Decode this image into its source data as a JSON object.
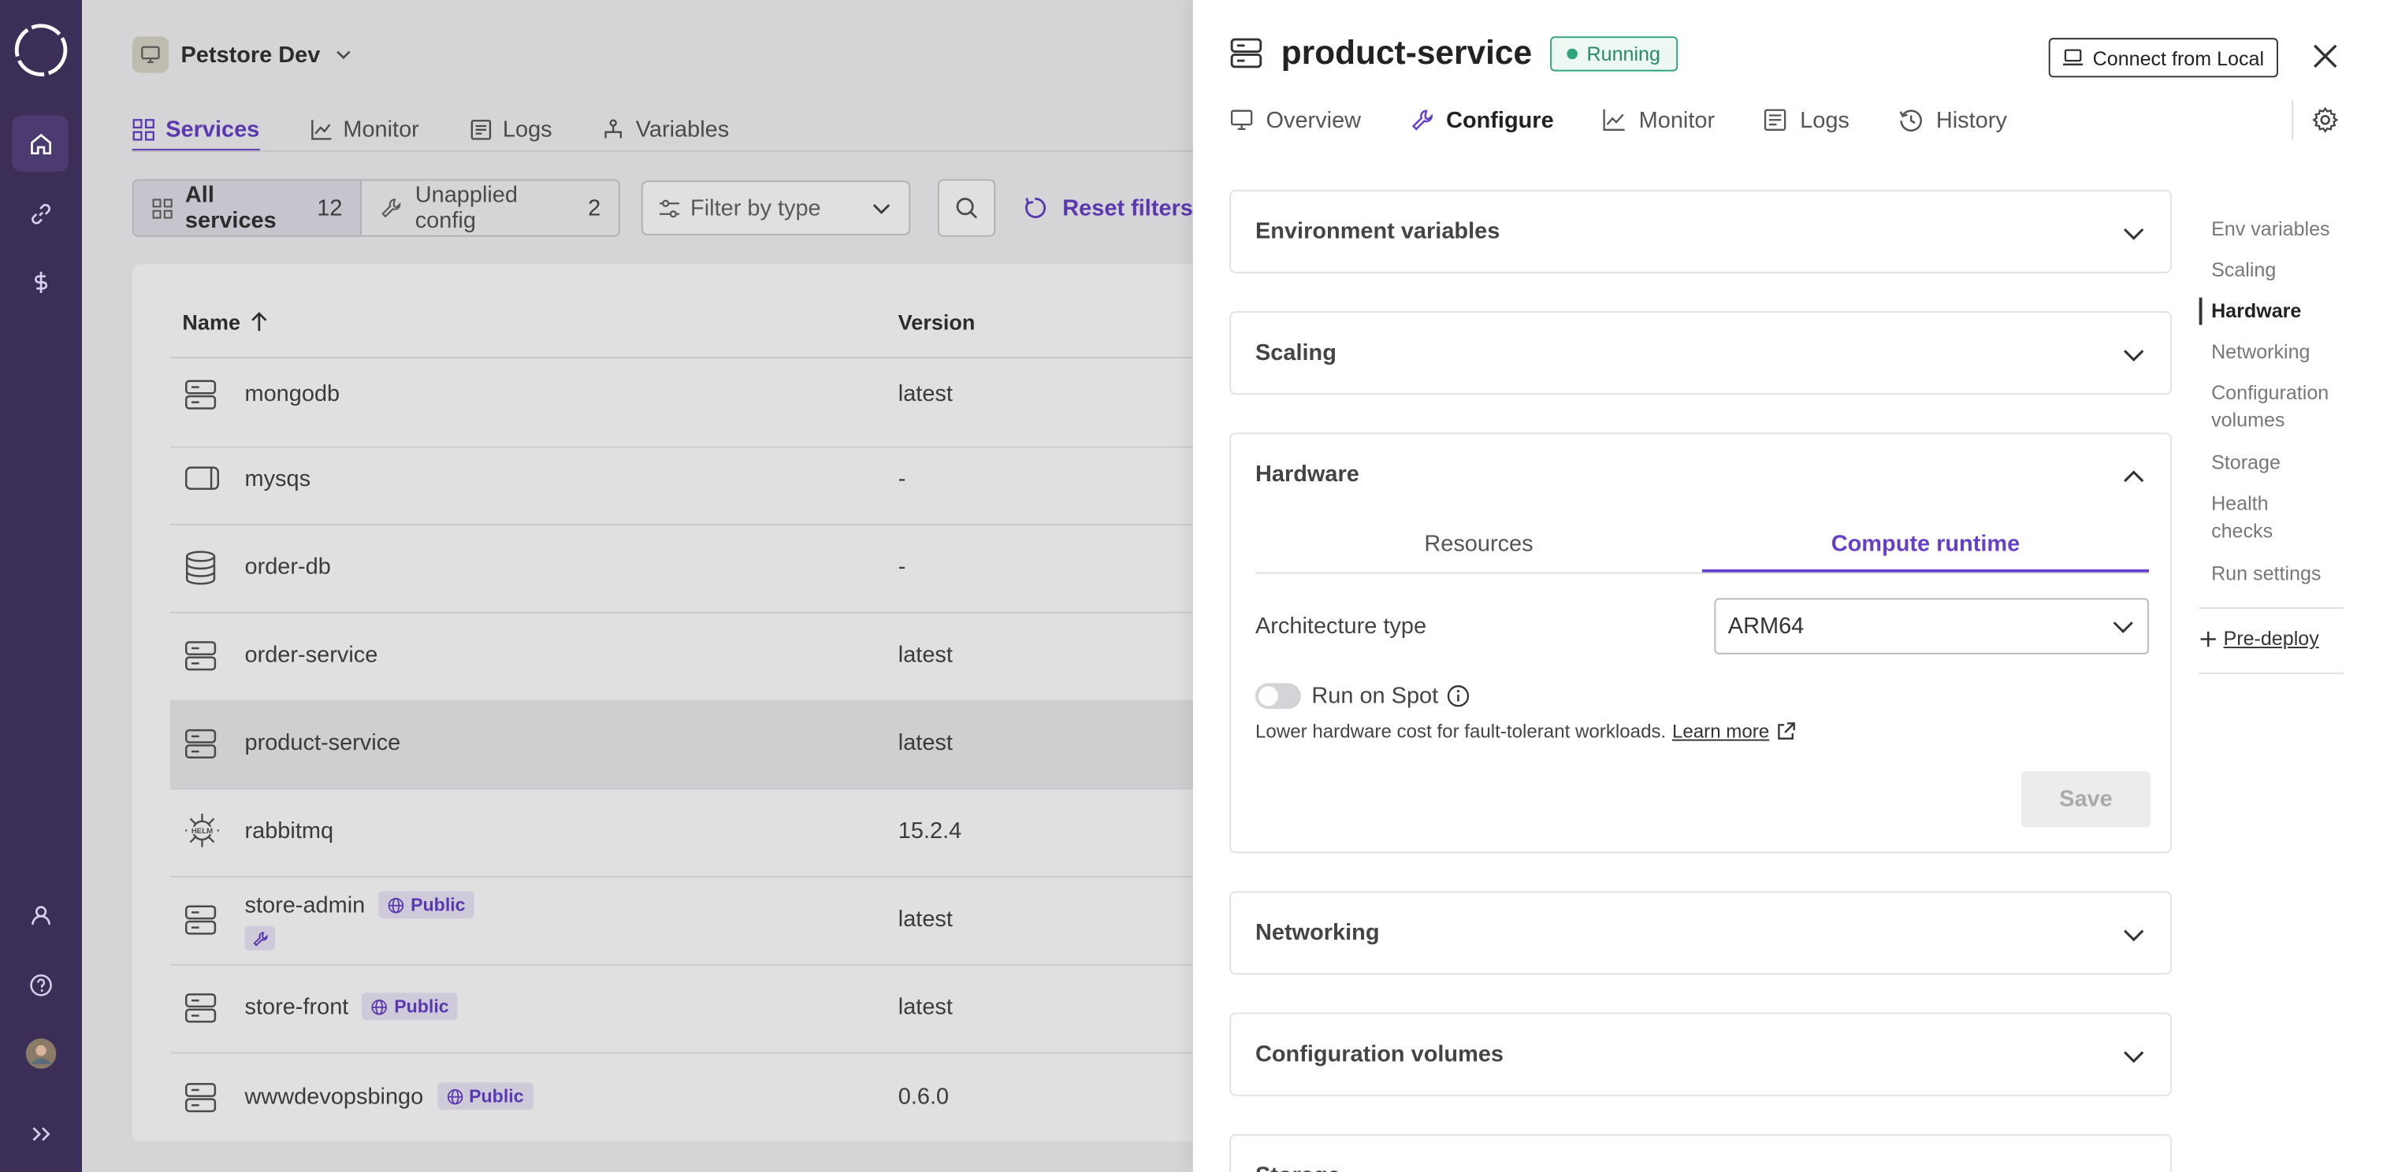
{
  "environment": {
    "name": "Petstore Dev"
  },
  "tabs": [
    {
      "label": "Services",
      "icon": "grid-icon"
    },
    {
      "label": "Monitor",
      "icon": "chart-icon"
    },
    {
      "label": "Logs",
      "icon": "logs-icon"
    },
    {
      "label": "Variables",
      "icon": "variables-icon"
    }
  ],
  "filters": {
    "all_services": "All services",
    "all_count": "12",
    "unapplied": "Unapplied config",
    "unapplied_count": "2",
    "filter_placeholder": "Filter by type",
    "reset": "Reset filters"
  },
  "table": {
    "col_name": "Name",
    "col_version": "Version",
    "rows": [
      {
        "name": "mongodb",
        "version": "latest",
        "icon": "server-icon"
      },
      {
        "name": "mysqs",
        "version": "-",
        "icon": "container-icon"
      },
      {
        "name": "order-db",
        "version": "-",
        "icon": "database-icon"
      },
      {
        "name": "order-service",
        "version": "latest",
        "icon": "server-icon"
      },
      {
        "name": "product-service",
        "version": "latest",
        "icon": "server-icon",
        "selected": true
      },
      {
        "name": "rabbitmq",
        "version": "15.2.4",
        "icon": "helm-icon"
      },
      {
        "name": "store-admin",
        "version": "latest",
        "icon": "server-icon",
        "badge": "Public"
      },
      {
        "name": "store-front",
        "version": "latest",
        "icon": "server-icon",
        "badge": "Public"
      },
      {
        "name": "wwwdevopsbingo",
        "version": "0.6.0",
        "icon": "server-icon",
        "badge": "Public"
      }
    ]
  },
  "panel": {
    "title": "product-service",
    "status": "Running",
    "connect": "Connect from Local",
    "tabs": [
      "Overview",
      "Configure",
      "Monitor",
      "Logs",
      "History"
    ],
    "active_tab": "Configure",
    "sections": {
      "env": "Environment variables",
      "scaling": "Scaling",
      "hardware": "Hardware",
      "networking": "Networking",
      "config_volumes": "Configuration volumes",
      "storage": "Storage"
    },
    "hardware": {
      "tab_resources": "Resources",
      "tab_compute": "Compute runtime",
      "arch_label": "Architecture type",
      "arch_value": "ARM64",
      "spot_label": "Run on Spot",
      "spot_help": "Lower hardware cost for fault-tolerant workloads.",
      "learn_more": "Learn more",
      "save": "Save"
    },
    "side_nav": [
      "Env variables",
      "Scaling",
      "Hardware",
      "Networking",
      "Configuration volumes",
      "Storage",
      "Health checks",
      "Run settings"
    ],
    "side_nav_active": "Hardware",
    "pre_deploy": "Pre-deploy"
  },
  "colors": {
    "accent": "#6740c8",
    "rail": "#3b2e57",
    "running": "#2fa37a"
  }
}
